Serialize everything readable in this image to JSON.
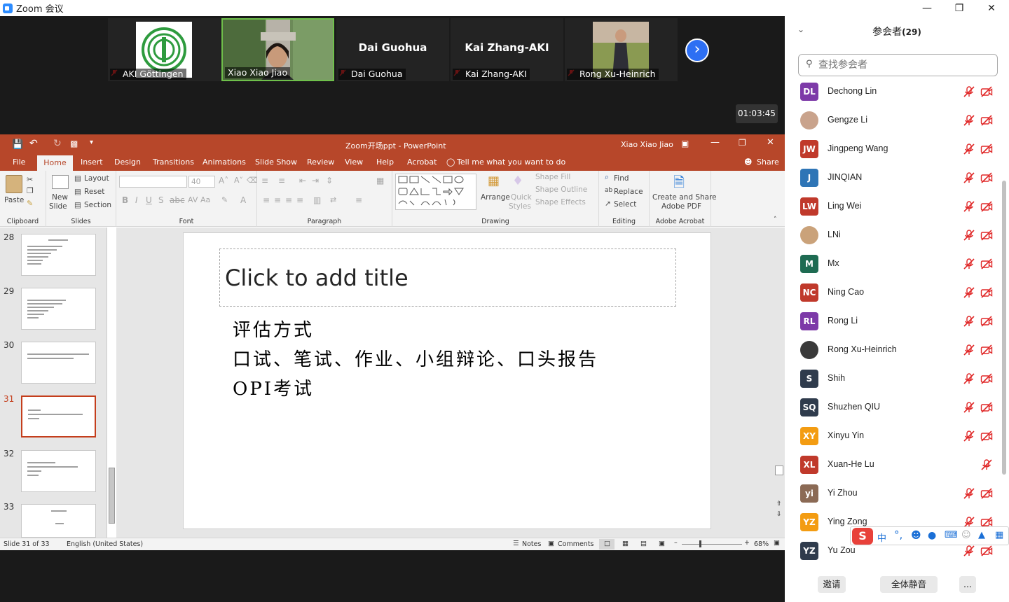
{
  "zoom": {
    "window_title": "Zoom 会议",
    "timer": "01:03:45",
    "tiles": [
      {
        "name": "AKI Göttingen"
      },
      {
        "name": "Xiao Xiao Jiao"
      },
      {
        "name": "Dai Guohua",
        "big": "Dai Guohua"
      },
      {
        "name": "Kai Zhang-AKI",
        "big": "Kai Zhang-AKI"
      },
      {
        "name": "Rong Xu-Heinrich"
      }
    ]
  },
  "ppt": {
    "title": "Zoom开场ppt  -  PowerPoint",
    "user": "Xiao Xiao Jiao",
    "tabs": [
      "File",
      "Home",
      "Insert",
      "Design",
      "Transitions",
      "Animations",
      "Slide Show",
      "Review",
      "View",
      "Help",
      "Acrobat"
    ],
    "tell_me": "Tell me what you want to do",
    "share": "Share",
    "ribbon": {
      "paste": "Paste",
      "clipboard": "Clipboard",
      "new_slide": "New",
      "new_slide2": "Slide",
      "layout": "Layout",
      "reset": "Reset",
      "section": "Section",
      "slides": "Slides",
      "font_size": "40",
      "font": "Font",
      "paragraph": "Paragraph",
      "arrange": "Arrange",
      "quick_styles": "Quick",
      "quick_styles2": "Styles",
      "shape_fill": "Shape Fill",
      "shape_outline": "Shape Outline",
      "shape_effects": "Shape Effects",
      "drawing": "Drawing",
      "find": "Find",
      "replace": "Replace",
      "select": "Select",
      "editing": "Editing",
      "create_pdf": "Create and Share",
      "create_pdf2": "Adobe PDF",
      "adobe": "Adobe Acrobat"
    },
    "slide_numbers": [
      "28",
      "29",
      "30",
      "31",
      "32",
      "33"
    ],
    "slide": {
      "title_placeholder": "Click to add title",
      "line1": "评估方式",
      "line2": "口试、笔试、作业、小组辩论、口头报告",
      "line3": "OPI考试"
    },
    "status": {
      "slide_of": "Slide 31 of 33",
      "language": "English (United States)",
      "notes": "Notes",
      "comments": "Comments",
      "zoom": "68%"
    }
  },
  "participants": {
    "header": "参会者",
    "count": "(29)",
    "search_placeholder": "查找参会者",
    "list": [
      {
        "initials": "DL",
        "name": "Dechong Lin",
        "color": "#7d3aa8"
      },
      {
        "initials": "",
        "name": "Gengze Li",
        "color": "#c9a38c"
      },
      {
        "initials": "JW",
        "name": "Jingpeng Wang",
        "color": "#c0392b"
      },
      {
        "initials": "J",
        "name": "JINQIAN",
        "color": "#2e75b6"
      },
      {
        "initials": "LW",
        "name": "Ling Wei",
        "color": "#c0392b"
      },
      {
        "initials": "",
        "name": "LNi",
        "color": "#caa27a"
      },
      {
        "initials": "M",
        "name": "Mx",
        "color": "#1e6b52"
      },
      {
        "initials": "NC",
        "name": "Ning Cao",
        "color": "#c0392b"
      },
      {
        "initials": "RL",
        "name": "Rong Li",
        "color": "#7d3aa8"
      },
      {
        "initials": "",
        "name": "Rong Xu-Heinrich",
        "color": "#3a3a3a"
      },
      {
        "initials": "S",
        "name": "Shih",
        "color": "#2f3b4c"
      },
      {
        "initials": "SQ",
        "name": "Shuzhen QIU",
        "color": "#2f3b4c"
      },
      {
        "initials": "XY",
        "name": "Xinyu Yin",
        "color": "#f39c12"
      },
      {
        "initials": "XL",
        "name": "Xuan-He Lu",
        "color": "#c0392b"
      },
      {
        "initials": "yi",
        "name": "Yi Zhou",
        "color": "#8b6a55"
      },
      {
        "initials": "YZ",
        "name": "Ying Zong",
        "color": "#f39c12"
      },
      {
        "initials": "YZ",
        "name": "Yu Zou",
        "color": "#2f3b4c"
      }
    ],
    "invite": "邀请",
    "mute_all": "全体静音",
    "more": "..."
  },
  "ime": {
    "lang": "中"
  }
}
